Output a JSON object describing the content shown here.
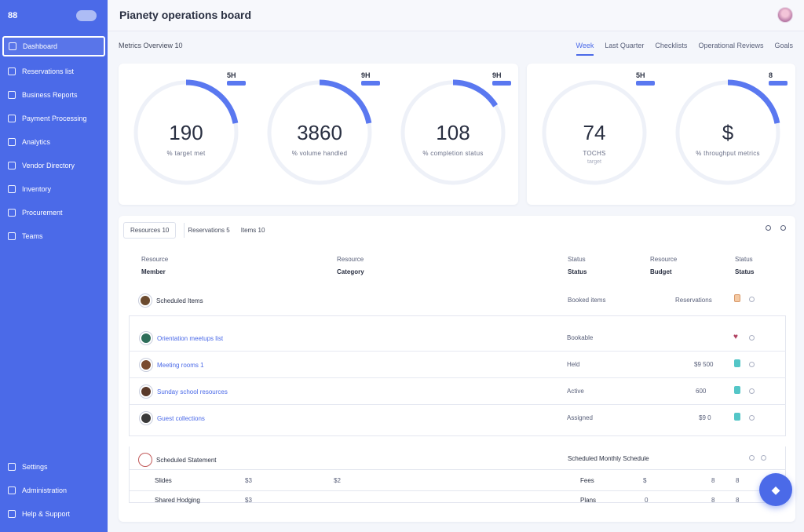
{
  "sidebar": {
    "logo": "88",
    "items": [
      {
        "label": "Dashboard"
      },
      {
        "label": "Reservations list"
      },
      {
        "label": "Business Reports"
      },
      {
        "label": "Payment Processing"
      },
      {
        "label": "Analytics"
      },
      {
        "label": "Vendor Directory"
      },
      {
        "label": "Inventory"
      },
      {
        "label": "Procurement"
      },
      {
        "label": "Teams"
      }
    ],
    "bottom_items": [
      {
        "label": "Settings"
      },
      {
        "label": "Administration"
      },
      {
        "label": "Help & Support"
      }
    ]
  },
  "header": {
    "title": "Pianety operations board"
  },
  "subbar": {
    "left_label": "Metrics Overview  10",
    "tabs": [
      "Week",
      "Last Quarter",
      "Checklists",
      "Operational Reviews",
      "Goals"
    ]
  },
  "gauges": [
    {
      "value": "190",
      "sub": "% target met",
      "tag": "5H",
      "fraction": 0.22
    },
    {
      "value": "3860",
      "sub": "% volume handled",
      "tag": "9H",
      "fraction": 0.22
    },
    {
      "value": "108",
      "sub": "% completion status",
      "tag": "9H",
      "fraction": 0.16
    },
    {
      "value": "74",
      "sub": "TOCHS",
      "sub2": "target",
      "tag": "5H",
      "fraction": 0.0
    },
    {
      "value": "$",
      "sub": "% throughput metrics",
      "tag": "8",
      "fraction": 0.22
    }
  ],
  "filters": [
    {
      "label": "Resources  10",
      "bordered": true
    },
    {
      "label": "Reservations  5",
      "bordered": false
    },
    {
      "label": "Items  10",
      "bordered": false
    }
  ],
  "table": {
    "headers": [
      {
        "top": "Resource",
        "bottom": "Member"
      },
      {
        "top": "Resource",
        "bottom": "Category"
      },
      {
        "top": "Status",
        "bottom": "Status"
      },
      {
        "top": "Resource",
        "bottom": "Budget"
      },
      {
        "top": "Status",
        "bottom": "Status"
      }
    ],
    "group_title": "Scheduled Items",
    "group_status": "Booked items",
    "group_right": "Reservations",
    "rows": [
      {
        "name": "Orientation meetups list",
        "status": "Bookable",
        "amount": "",
        "color": "#4b4b4b"
      },
      {
        "name": "Meeting rooms  1",
        "status": "Held",
        "amount": "$9 500",
        "color": "#7a4b2e"
      },
      {
        "name": "Sunday school resources",
        "status": "Active",
        "amount": "600",
        "color": "#5a3a2a"
      },
      {
        "name": "Guest collections",
        "status": "Assigned",
        "amount": "$9  0",
        "color": "#3a3a3a"
      }
    ],
    "section2_title": "Scheduled Statement",
    "section2_mid": "Scheduled  Monthly Schedule",
    "section2_rows": [
      {
        "a": "Slides",
        "b": "$3",
        "c": "$2",
        "d": "Fees",
        "e": "$",
        "f": "8",
        "g": "8"
      },
      {
        "a": "Shared Hodging",
        "b": "$3",
        "c": "",
        "d": "Plans",
        "e": "0",
        "f": "8",
        "g": "8"
      }
    ]
  },
  "colors": {
    "accent": "#4b6ae8",
    "gauge_track": "#eef1f8"
  }
}
